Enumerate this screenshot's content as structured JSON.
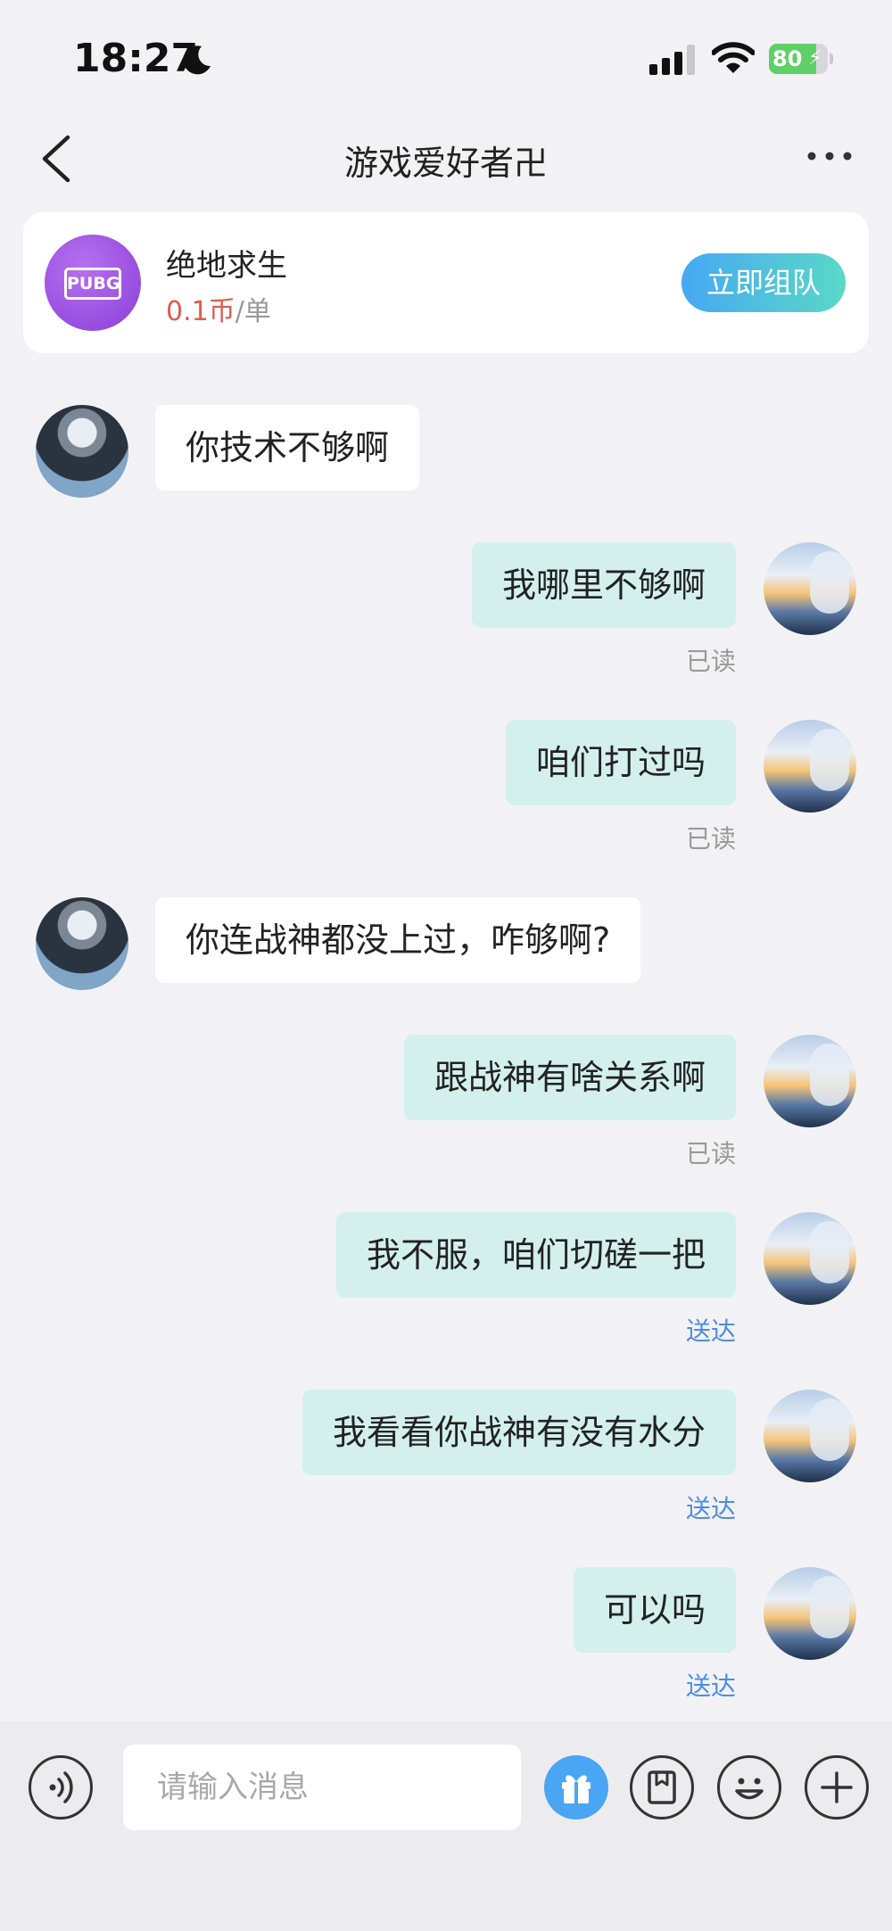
{
  "status_bar": {
    "time": "18:27",
    "battery_level": 80,
    "battery_text": "80"
  },
  "nav": {
    "title": "游戏爱好者卍"
  },
  "game_card": {
    "logo_text": "PUBG",
    "name": "绝地求生",
    "price": "0.1币",
    "unit": "/单",
    "team_button": "立即组队"
  },
  "messages": [
    {
      "side": "left",
      "text": "你技术不够啊"
    },
    {
      "side": "right",
      "text": "我哪里不够啊",
      "receipt": "已读"
    },
    {
      "side": "right",
      "text": "咱们打过吗",
      "receipt": "已读"
    },
    {
      "side": "left",
      "text": "你连战神都没上过，咋够啊?"
    },
    {
      "side": "right",
      "text": "跟战神有啥关系啊",
      "receipt": "已读"
    },
    {
      "side": "right",
      "text": "我不服，咱们切磋一把",
      "receipt": "送达"
    },
    {
      "side": "right",
      "text": "我看看你战神有没有水分",
      "receipt": "送达"
    },
    {
      "side": "right",
      "text": "可以吗",
      "receipt": "送达"
    }
  ],
  "input_bar": {
    "placeholder": "请输入消息",
    "value": ""
  },
  "colors": {
    "accent_blue": "#4d8be8",
    "bubble_self": "#d3f0ec",
    "price_red": "#e05a4e",
    "read_gray": "#999999"
  }
}
